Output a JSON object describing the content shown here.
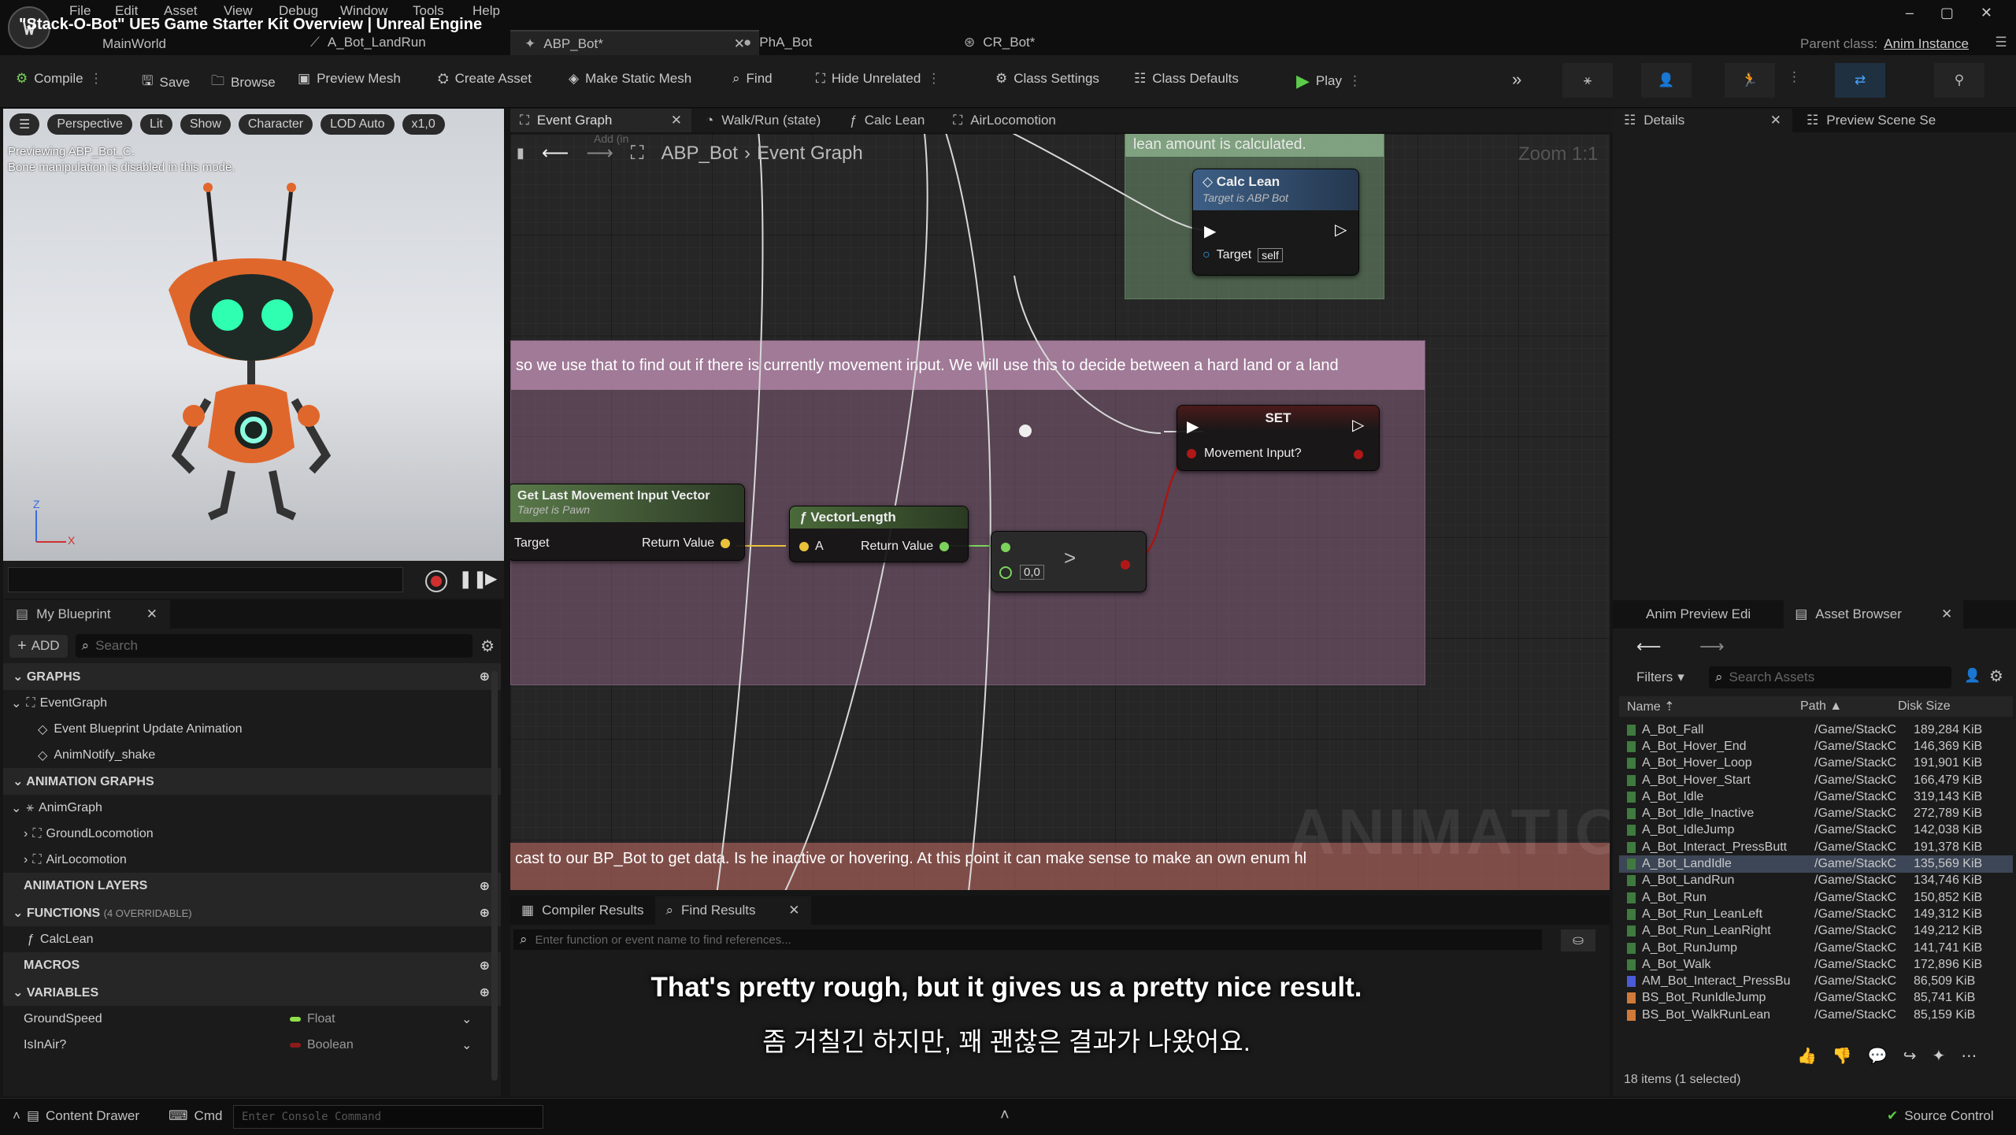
{
  "app": {
    "title": "\"Stack-O-Bot\" UE5 Game Starter Kit Overview | Unreal Engine",
    "menu": [
      "File",
      "Edit",
      "Asset",
      "View",
      "Debug",
      "Window",
      "Tools",
      "Help"
    ],
    "doc_tabs": [
      {
        "label": "MainWorld"
      },
      {
        "label": "A_Bot_LandRun"
      },
      {
        "label": "ABP_Bot*"
      },
      {
        "label": "PhA_Bot"
      },
      {
        "label": "CR_Bot*"
      }
    ],
    "parent_class_label": "Parent class:",
    "parent_class_value": "Anim Instance",
    "window_controls": [
      "–",
      "▢",
      "✕"
    ]
  },
  "toolbar": {
    "compile": "Compile",
    "save": "Save",
    "browse": "Browse",
    "preview_mesh": "Preview Mesh",
    "create_asset": "Create Asset",
    "make_static_mesh": "Make Static Mesh",
    "find": "Find",
    "hide_unrelated": "Hide Unrelated",
    "class_settings": "Class Settings",
    "class_defaults": "Class Defaults",
    "play": "Play"
  },
  "viewport": {
    "buttons": [
      "Perspective",
      "Lit",
      "Show",
      "Character",
      "LOD Auto",
      "x1,0"
    ],
    "overlay_line1": "Previewing ABP_Bot_C.",
    "overlay_line2": "Bone manipulation is disabled in this mode.",
    "axis_z": "Z",
    "axis_x": "X"
  },
  "my_blueprint": {
    "tab": "My Blueprint",
    "add": "ADD",
    "search_placeholder": "Search",
    "sections": {
      "graphs": "GRAPHS",
      "animation_graphs": "ANIMATION GRAPHS",
      "animation_layers": "ANIMATION LAYERS",
      "functions": "FUNCTIONS",
      "functions_note": "(4 OVERRIDABLE)",
      "macros": "MACROS",
      "variables": "VARIABLES"
    },
    "graphs": [
      "EventGraph",
      "Event Blueprint Update Animation",
      "AnimNotify_shake"
    ],
    "anim_graphs": [
      "AnimGraph",
      "GroundLocomotion",
      "AirLocomotion"
    ],
    "functions": [
      "CalcLean"
    ],
    "variables": [
      {
        "name": "GroundSpeed",
        "type": "Float",
        "color": "#8fe04a"
      },
      {
        "name": "IsInAir?",
        "type": "Boolean",
        "color": "#8c1b1b"
      }
    ]
  },
  "graph": {
    "tabs": [
      "Event Graph",
      "Walk/Run (state)",
      "Calc Lean",
      "AirLocomotion"
    ],
    "breadcrumb_root": "ABP_Bot",
    "breadcrumb_sep": "›",
    "breadcrumb_leaf": "Event Graph",
    "zoom": "Zoom 1:1",
    "add_hint": "Add (in",
    "comment_top_tail": "lean amount is calculated.",
    "comment_mid": "so we use that to find out if there is currently movement input. We will use this to decide between a hard land or a land",
    "comment_bottom": "cast to our BP_Bot to get data. Is he inactive or hovering. At this point it can make sense to make an own enum hl",
    "watermark": "ANIMATION",
    "nodes": {
      "calc_lean": {
        "title": "Calc Lean",
        "subtitle": "Target is ABP Bot",
        "pin_target": "Target",
        "self": "self"
      },
      "set": {
        "title": "SET",
        "pin": "Movement Input?"
      },
      "get_last": {
        "title": "Get Last Movement Input Vector",
        "subtitle": "Target is Pawn",
        "pin_in": "Target",
        "pin_out": "Return Value"
      },
      "vector_length": {
        "title": "VectorLength",
        "pin_in": "A",
        "pin_out": "Return Value"
      },
      "greater": {
        "op": ">",
        "value": "0,0"
      }
    }
  },
  "bottom": {
    "tabs": [
      "Compiler Results",
      "Find Results"
    ],
    "find_placeholder": "Enter function or event name to find references...",
    "subtitle_en": "That's pretty rough, but it gives us a pretty nice result.",
    "subtitle_ko": "좀 거칠긴 하지만, 꽤 괜찮은 결과가 나왔어요."
  },
  "details": {
    "tab": "Details",
    "tab2": "Preview Scene Se"
  },
  "asset_browser": {
    "tab_left": "Anim Preview Edi",
    "tab": "Asset Browser",
    "filters": "Filters",
    "search_placeholder": "Search Assets",
    "columns": {
      "name": "Name",
      "path": "Path",
      "size": "Disk Size"
    },
    "rows": [
      {
        "name": "A_Bot_Fall",
        "path": "/Game/StackC",
        "size": "189,284 KiB",
        "color": "#3f7a3f"
      },
      {
        "name": "A_Bot_Hover_End",
        "path": "/Game/StackC",
        "size": "146,369 KiB",
        "color": "#3f7a3f"
      },
      {
        "name": "A_Bot_Hover_Loop",
        "path": "/Game/StackC",
        "size": "191,901 KiB",
        "color": "#3f7a3f"
      },
      {
        "name": "A_Bot_Hover_Start",
        "path": "/Game/StackC",
        "size": "166,479 KiB",
        "color": "#3f7a3f"
      },
      {
        "name": "A_Bot_Idle",
        "path": "/Game/StackC",
        "size": "319,143 KiB",
        "color": "#3f7a3f"
      },
      {
        "name": "A_Bot_Idle_Inactive",
        "path": "/Game/StackC",
        "size": "272,789 KiB",
        "color": "#3f7a3f"
      },
      {
        "name": "A_Bot_IdleJump",
        "path": "/Game/StackC",
        "size": "142,038 KiB",
        "color": "#3f7a3f"
      },
      {
        "name": "A_Bot_Interact_PressButt",
        "path": "/Game/StackC",
        "size": "191,378 KiB",
        "color": "#3f7a3f"
      },
      {
        "name": "A_Bot_LandIdle",
        "path": "/Game/StackC",
        "size": "135,569 KiB",
        "color": "#3f7a3f"
      },
      {
        "name": "A_Bot_LandRun",
        "path": "/Game/StackC",
        "size": "134,746 KiB",
        "color": "#3f7a3f"
      },
      {
        "name": "A_Bot_Run",
        "path": "/Game/StackC",
        "size": "150,852 KiB",
        "color": "#3f7a3f"
      },
      {
        "name": "A_Bot_Run_LeanLeft",
        "path": "/Game/StackC",
        "size": "149,312 KiB",
        "color": "#3f7a3f"
      },
      {
        "name": "A_Bot_Run_LeanRight",
        "path": "/Game/StackC",
        "size": "149,212 KiB",
        "color": "#3f7a3f"
      },
      {
        "name": "A_Bot_RunJump",
        "path": "/Game/StackC",
        "size": "141,741 KiB",
        "color": "#3f7a3f"
      },
      {
        "name": "A_Bot_Walk",
        "path": "/Game/StackC",
        "size": "172,896 KiB",
        "color": "#3f7a3f"
      },
      {
        "name": "AM_Bot_Interact_PressBu",
        "path": "/Game/StackC",
        "size": "86,509 KiB",
        "color": "#4a5bd6"
      },
      {
        "name": "BS_Bot_RunIdleJump",
        "path": "/Game/StackC",
        "size": "85,741 KiB",
        "color": "#d07a3a"
      },
      {
        "name": "BS_Bot_WalkRunLean",
        "path": "/Game/StackC",
        "size": "85,159 KiB",
        "color": "#d07a3a"
      }
    ],
    "selected_row": 8,
    "footer": "18 items (1 selected)"
  },
  "statusbar": {
    "content_drawer": "Content Drawer",
    "cmd": "Cmd",
    "console_placeholder": "Enter Console Command",
    "source_control": "Source Control"
  }
}
